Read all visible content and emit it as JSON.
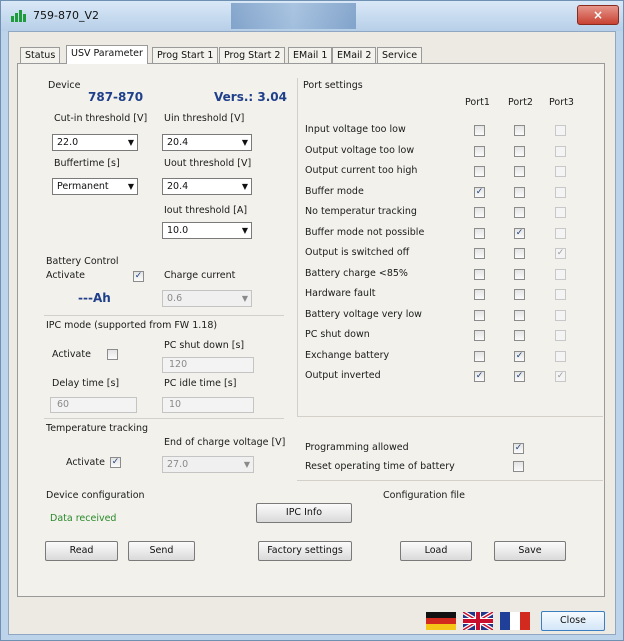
{
  "window": {
    "title": "759-870_V2",
    "close_glyph": "×"
  },
  "tabs": [
    {
      "label": "Status"
    },
    {
      "label": "USV Parameter"
    },
    {
      "label": "Prog Start 1"
    },
    {
      "label": "Prog Start 2"
    },
    {
      "label": "EMail 1"
    },
    {
      "label": "EMail 2"
    },
    {
      "label": "Service"
    }
  ],
  "device": {
    "label": "Device",
    "number": "787-870",
    "version": "Vers.: 3.04",
    "cutin_label": "Cut-in threshold [V]",
    "cutin_value": "22.0",
    "uin_label": "Uin threshold [V]",
    "uin_value": "20.4",
    "buffertime_label": "Buffertime [s]",
    "buffertime_value": "Permanent",
    "uout_label": "Uout threshold [V]",
    "uout_value": "20.4",
    "iout_label": "Iout threshold [A]",
    "iout_value": "10.0"
  },
  "battery": {
    "title": "Battery Control",
    "activate_label": "Activate",
    "activate_glyph": "✓",
    "capacity": "---Ah",
    "charge_current_label": "Charge current",
    "charge_current_value": "0.6"
  },
  "ipc": {
    "title": "IPC mode (supported from FW 1.18)",
    "activate_label": "Activate",
    "shutdown_label": "PC shut down [s]",
    "shutdown_value": "120",
    "delay_label": "Delay time [s]",
    "delay_value": "60",
    "idle_label": "PC idle time [s]",
    "idle_value": "10"
  },
  "temperature": {
    "title": "Temperature tracking",
    "activate_label": "Activate",
    "activate_glyph": "✓",
    "eoc_label": "End of charge voltage [V]",
    "eoc_value": "27.0"
  },
  "port_settings": {
    "title": "Port settings",
    "columns": [
      "Port1",
      "Port2",
      "Port3"
    ],
    "rows": [
      {
        "label": "Input voltage too low",
        "checks": [
          "",
          "",
          ""
        ]
      },
      {
        "label": "Output voltage too low",
        "checks": [
          "",
          "",
          ""
        ]
      },
      {
        "label": "Output current too high",
        "checks": [
          "",
          "",
          ""
        ]
      },
      {
        "label": "Buffer mode",
        "checks": [
          "✓",
          "",
          ""
        ]
      },
      {
        "label": "No temperatur tracking",
        "checks": [
          "",
          "",
          ""
        ]
      },
      {
        "label": "Buffer mode not possible",
        "checks": [
          "",
          "✓",
          ""
        ]
      },
      {
        "label": "Output is switched off",
        "checks": [
          "",
          "",
          "✓"
        ]
      },
      {
        "label": "Battery charge <85%",
        "checks": [
          "",
          "",
          ""
        ]
      },
      {
        "label": "Hardware fault",
        "checks": [
          "",
          "",
          ""
        ]
      },
      {
        "label": "Battery voltage very low",
        "checks": [
          "",
          "",
          ""
        ]
      },
      {
        "label": "PC shut down",
        "checks": [
          "",
          "",
          ""
        ]
      },
      {
        "label": "Exchange battery",
        "checks": [
          "",
          "✓",
          ""
        ]
      },
      {
        "label": "Output inverted",
        "checks": [
          "✓",
          "✓",
          "✓"
        ]
      }
    ],
    "programming_label": "Programming allowed",
    "programming_glyph": "✓",
    "reset_label": "Reset operating time of battery"
  },
  "device_config": {
    "title": "Device configuration",
    "status": "Data received",
    "read": "Read",
    "send": "Send",
    "ipc_info": "IPC Info",
    "factory": "Factory settings"
  },
  "config_file": {
    "title": "Configuration file",
    "load": "Load",
    "save": "Save"
  },
  "footer": {
    "close": "Close"
  },
  "colors": {
    "window_frame": "#bcd3ea",
    "panel": "#f2f1ec",
    "value_blue": "#1f3f8a",
    "status_green": "#2a8a2a"
  }
}
